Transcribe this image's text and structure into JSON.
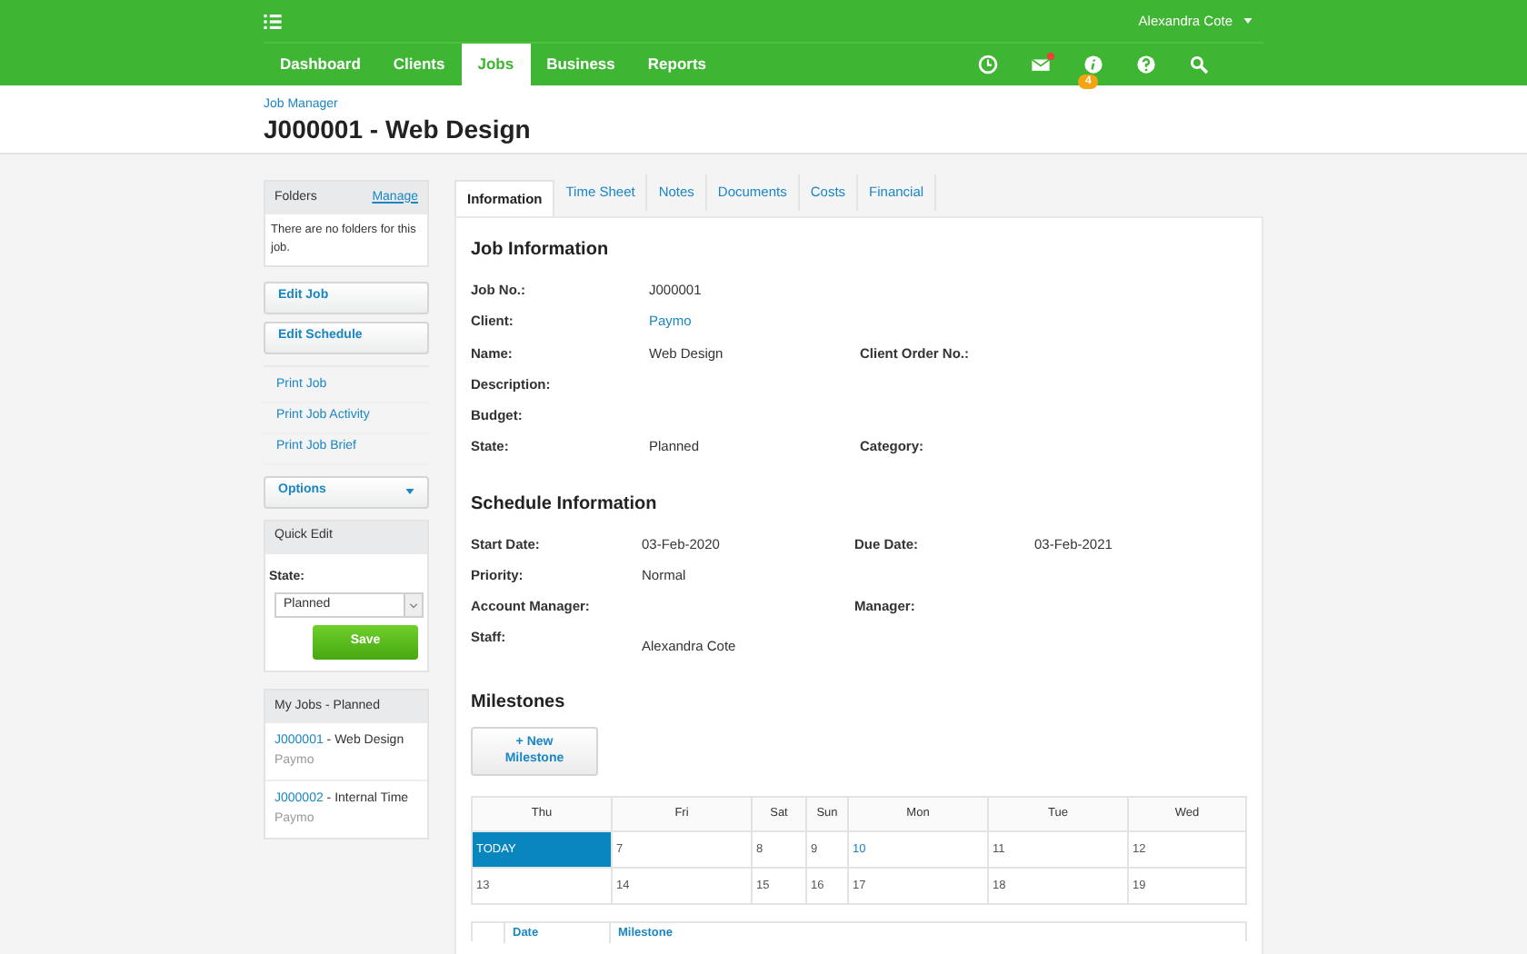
{
  "top_bar": {
    "user": "Alexandra Cote"
  },
  "nav": [
    {
      "label": "Dashboard",
      "selected": false
    },
    {
      "label": "Clients",
      "selected": false
    },
    {
      "label": "Jobs",
      "selected": true
    },
    {
      "label": "Business",
      "selected": false
    },
    {
      "label": "Reports",
      "selected": false
    }
  ],
  "header_icons": {
    "mail_unread": true,
    "info_badge": "4"
  },
  "breadcrumb": "Job Manager",
  "page_title": "J000001 - Web Design",
  "sidebar": {
    "folders": {
      "title": "Folders",
      "action": "Manage",
      "empty_text": "There are no folders for this job."
    },
    "actions": [
      "Edit Job",
      "Edit Schedule"
    ],
    "print_links": [
      "Print Job",
      "Print Job Activity",
      "Print Job Brief"
    ],
    "options": "Options",
    "quick_edit": {
      "title": "Quick Edit",
      "field_label": "State:",
      "value": "Planned",
      "button": "Save"
    },
    "my_jobs": {
      "title": "My Jobs - Planned",
      "items": [
        {
          "code": "J000001",
          "name": " - Web Design",
          "client": "Paymo"
        },
        {
          "code": "J000002",
          "name": " - Internal Time",
          "client": "Paymo"
        }
      ]
    }
  },
  "tabs": [
    {
      "label": "Information",
      "selected": true
    },
    {
      "label": "Time Sheet",
      "selected": false
    },
    {
      "label": "Notes",
      "selected": false
    },
    {
      "label": "Documents",
      "selected": false
    },
    {
      "label": "Costs",
      "selected": false
    },
    {
      "label": "Financial",
      "selected": false
    }
  ],
  "job_information": {
    "title": "Job Information",
    "rows": [
      {
        "label": "Job No.:",
        "value": "J000001",
        "kind": "text"
      },
      {
        "label": "Client:",
        "value": "Paymo",
        "kind": "link"
      },
      {
        "label": "Name:",
        "value": "Web Design",
        "kind": "text",
        "label_2": "Client Order No.:"
      },
      {
        "label": "Description:"
      },
      {
        "label": "Budget:"
      },
      {
        "label": "State:",
        "value": "Planned",
        "kind": "text",
        "label_2": "Category:"
      }
    ]
  },
  "schedule_information": {
    "title": "Schedule Information",
    "rows": [
      {
        "label": "Start Date:",
        "value": "03-Feb-2020",
        "label_2": "Due Date:",
        "value_2": "03-Feb-2021"
      },
      {
        "label": "Priority:",
        "value": "Normal"
      },
      {
        "label": "Account Manager:",
        "label_2": "Manager:"
      },
      {
        "label": "Staff:",
        "value": "Alexandra Cote"
      }
    ]
  },
  "milestones": {
    "title": "Milestones",
    "button": "+ New Milestone",
    "calendar": {
      "days": [
        "Thu",
        "Fri",
        "Sat",
        "Sun",
        "Mon",
        "Tue",
        "Wed"
      ],
      "weeks": [
        [
          {
            "text": "TODAY",
            "selected": true,
            "marked": false
          },
          {
            "text": "7",
            "selected": false,
            "marked": false
          },
          {
            "text": "8",
            "selected": false,
            "marked": false
          },
          {
            "text": "9",
            "selected": false,
            "marked": false
          },
          {
            "text": "10",
            "selected": false,
            "marked": true
          },
          {
            "text": "11",
            "selected": false,
            "marked": false
          },
          {
            "text": "12",
            "selected": false,
            "marked": false
          }
        ],
        [
          {
            "text": "13",
            "selected": false,
            "marked": false
          },
          {
            "text": "14",
            "selected": false,
            "marked": false
          },
          {
            "text": "15",
            "selected": false,
            "marked": false
          },
          {
            "text": "16",
            "selected": false,
            "marked": false
          },
          {
            "text": "17",
            "selected": false,
            "marked": false
          },
          {
            "text": "18",
            "selected": false,
            "marked": false
          },
          {
            "text": "19",
            "selected": false,
            "marked": false
          }
        ]
      ]
    },
    "table_columns": [
      "Date",
      "Milestone"
    ]
  }
}
